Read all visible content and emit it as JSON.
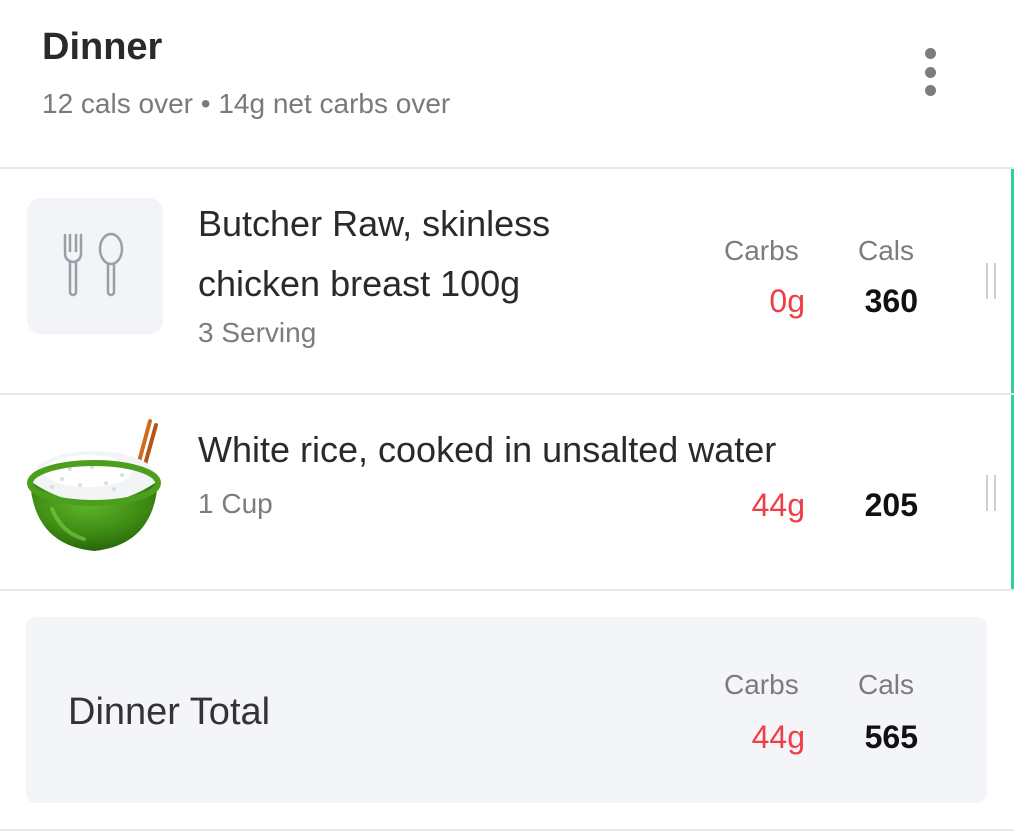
{
  "meal": {
    "title": "Dinner",
    "summary": "12 cals over • 14g net carbs over"
  },
  "columns": {
    "carbs": "Carbs",
    "cals": "Cals"
  },
  "items": [
    {
      "name_line1": "Butcher Raw, skinless",
      "name_line2": "chicken breast 100g",
      "serving": "3 Serving",
      "carbs": "0g",
      "cals": "360",
      "icon": "fork-spoon-icon"
    },
    {
      "name_line1": "White rice, cooked in unsalted water",
      "serving": "1 Cup",
      "carbs": "44g",
      "cals": "205",
      "icon": "rice-bowl-icon"
    }
  ],
  "total": {
    "label": "Dinner Total",
    "carbs": "44g",
    "cals": "565"
  },
  "colors": {
    "accent": "#2fd39a",
    "over_carbs": "#ef3e45",
    "total_bg": "#f4f5f9"
  }
}
